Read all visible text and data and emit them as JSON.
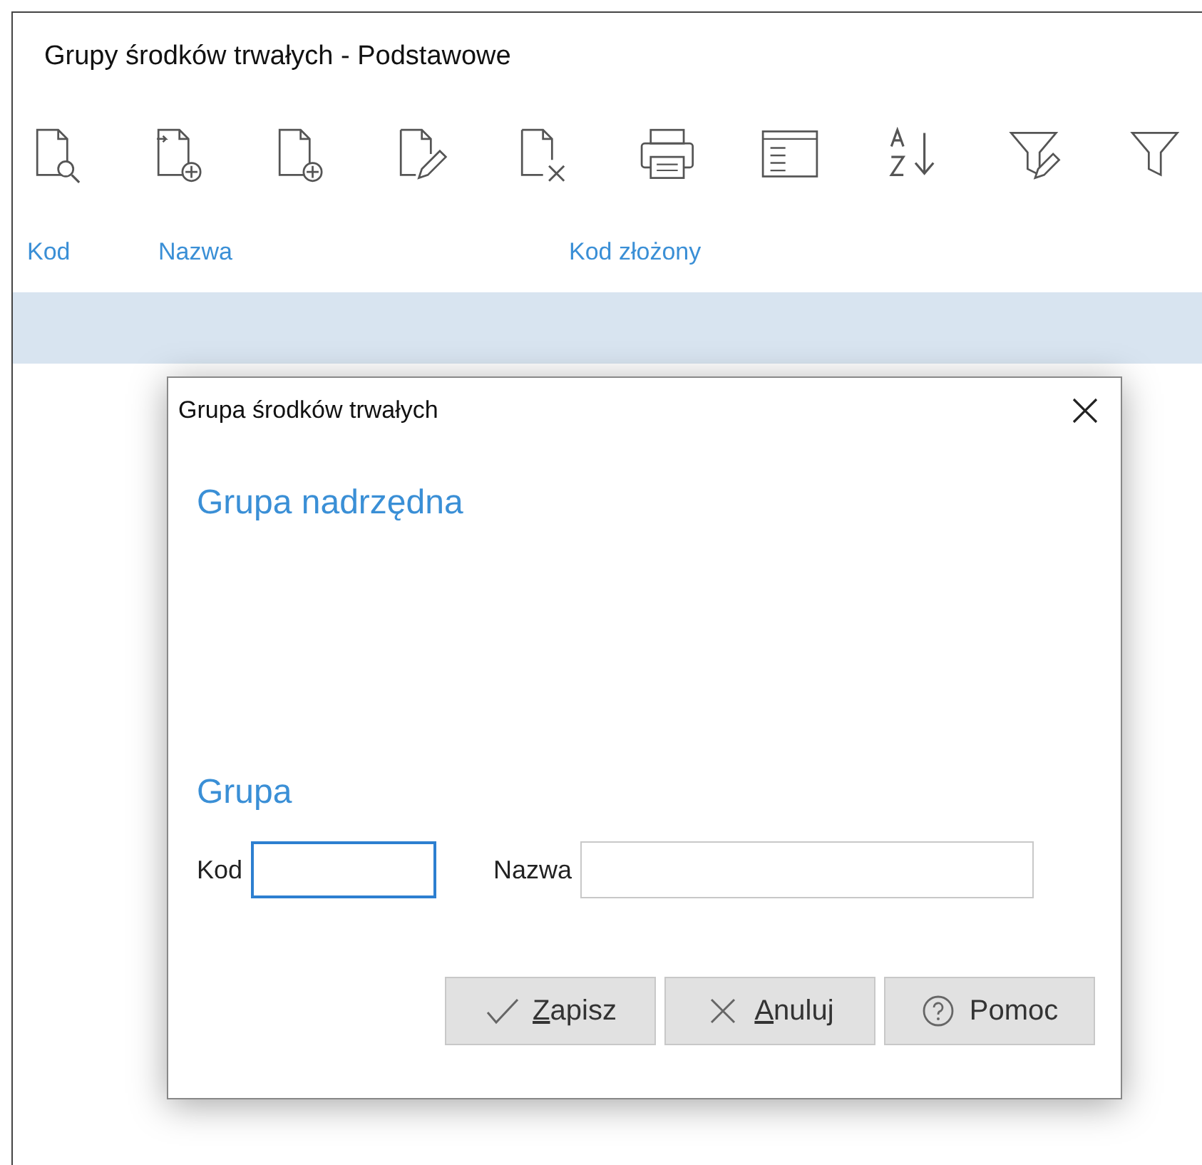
{
  "window": {
    "title": "Grupy środków trwałych - Podstawowe"
  },
  "table": {
    "columns": [
      "Kod",
      "Nazwa",
      "Kod złożony"
    ],
    "rows": [
      {
        "selected": true
      }
    ]
  },
  "dialog": {
    "title": "Grupa środków trwałych",
    "sections": [
      {
        "heading": "Grupa nadrzędna"
      },
      {
        "heading": "Grupa"
      }
    ],
    "fields": [
      {
        "label": "Kod",
        "focused": true
      },
      {
        "label": "Nazwa",
        "focused": false
      }
    ],
    "buttons": [
      {
        "kind": "save",
        "label": "Zapisz",
        "mnemonic": true
      },
      {
        "kind": "cancel",
        "label": "Anuluj",
        "mnemonic": true
      },
      {
        "kind": "help",
        "label": "Pomoc",
        "mnemonic": false
      }
    ]
  }
}
